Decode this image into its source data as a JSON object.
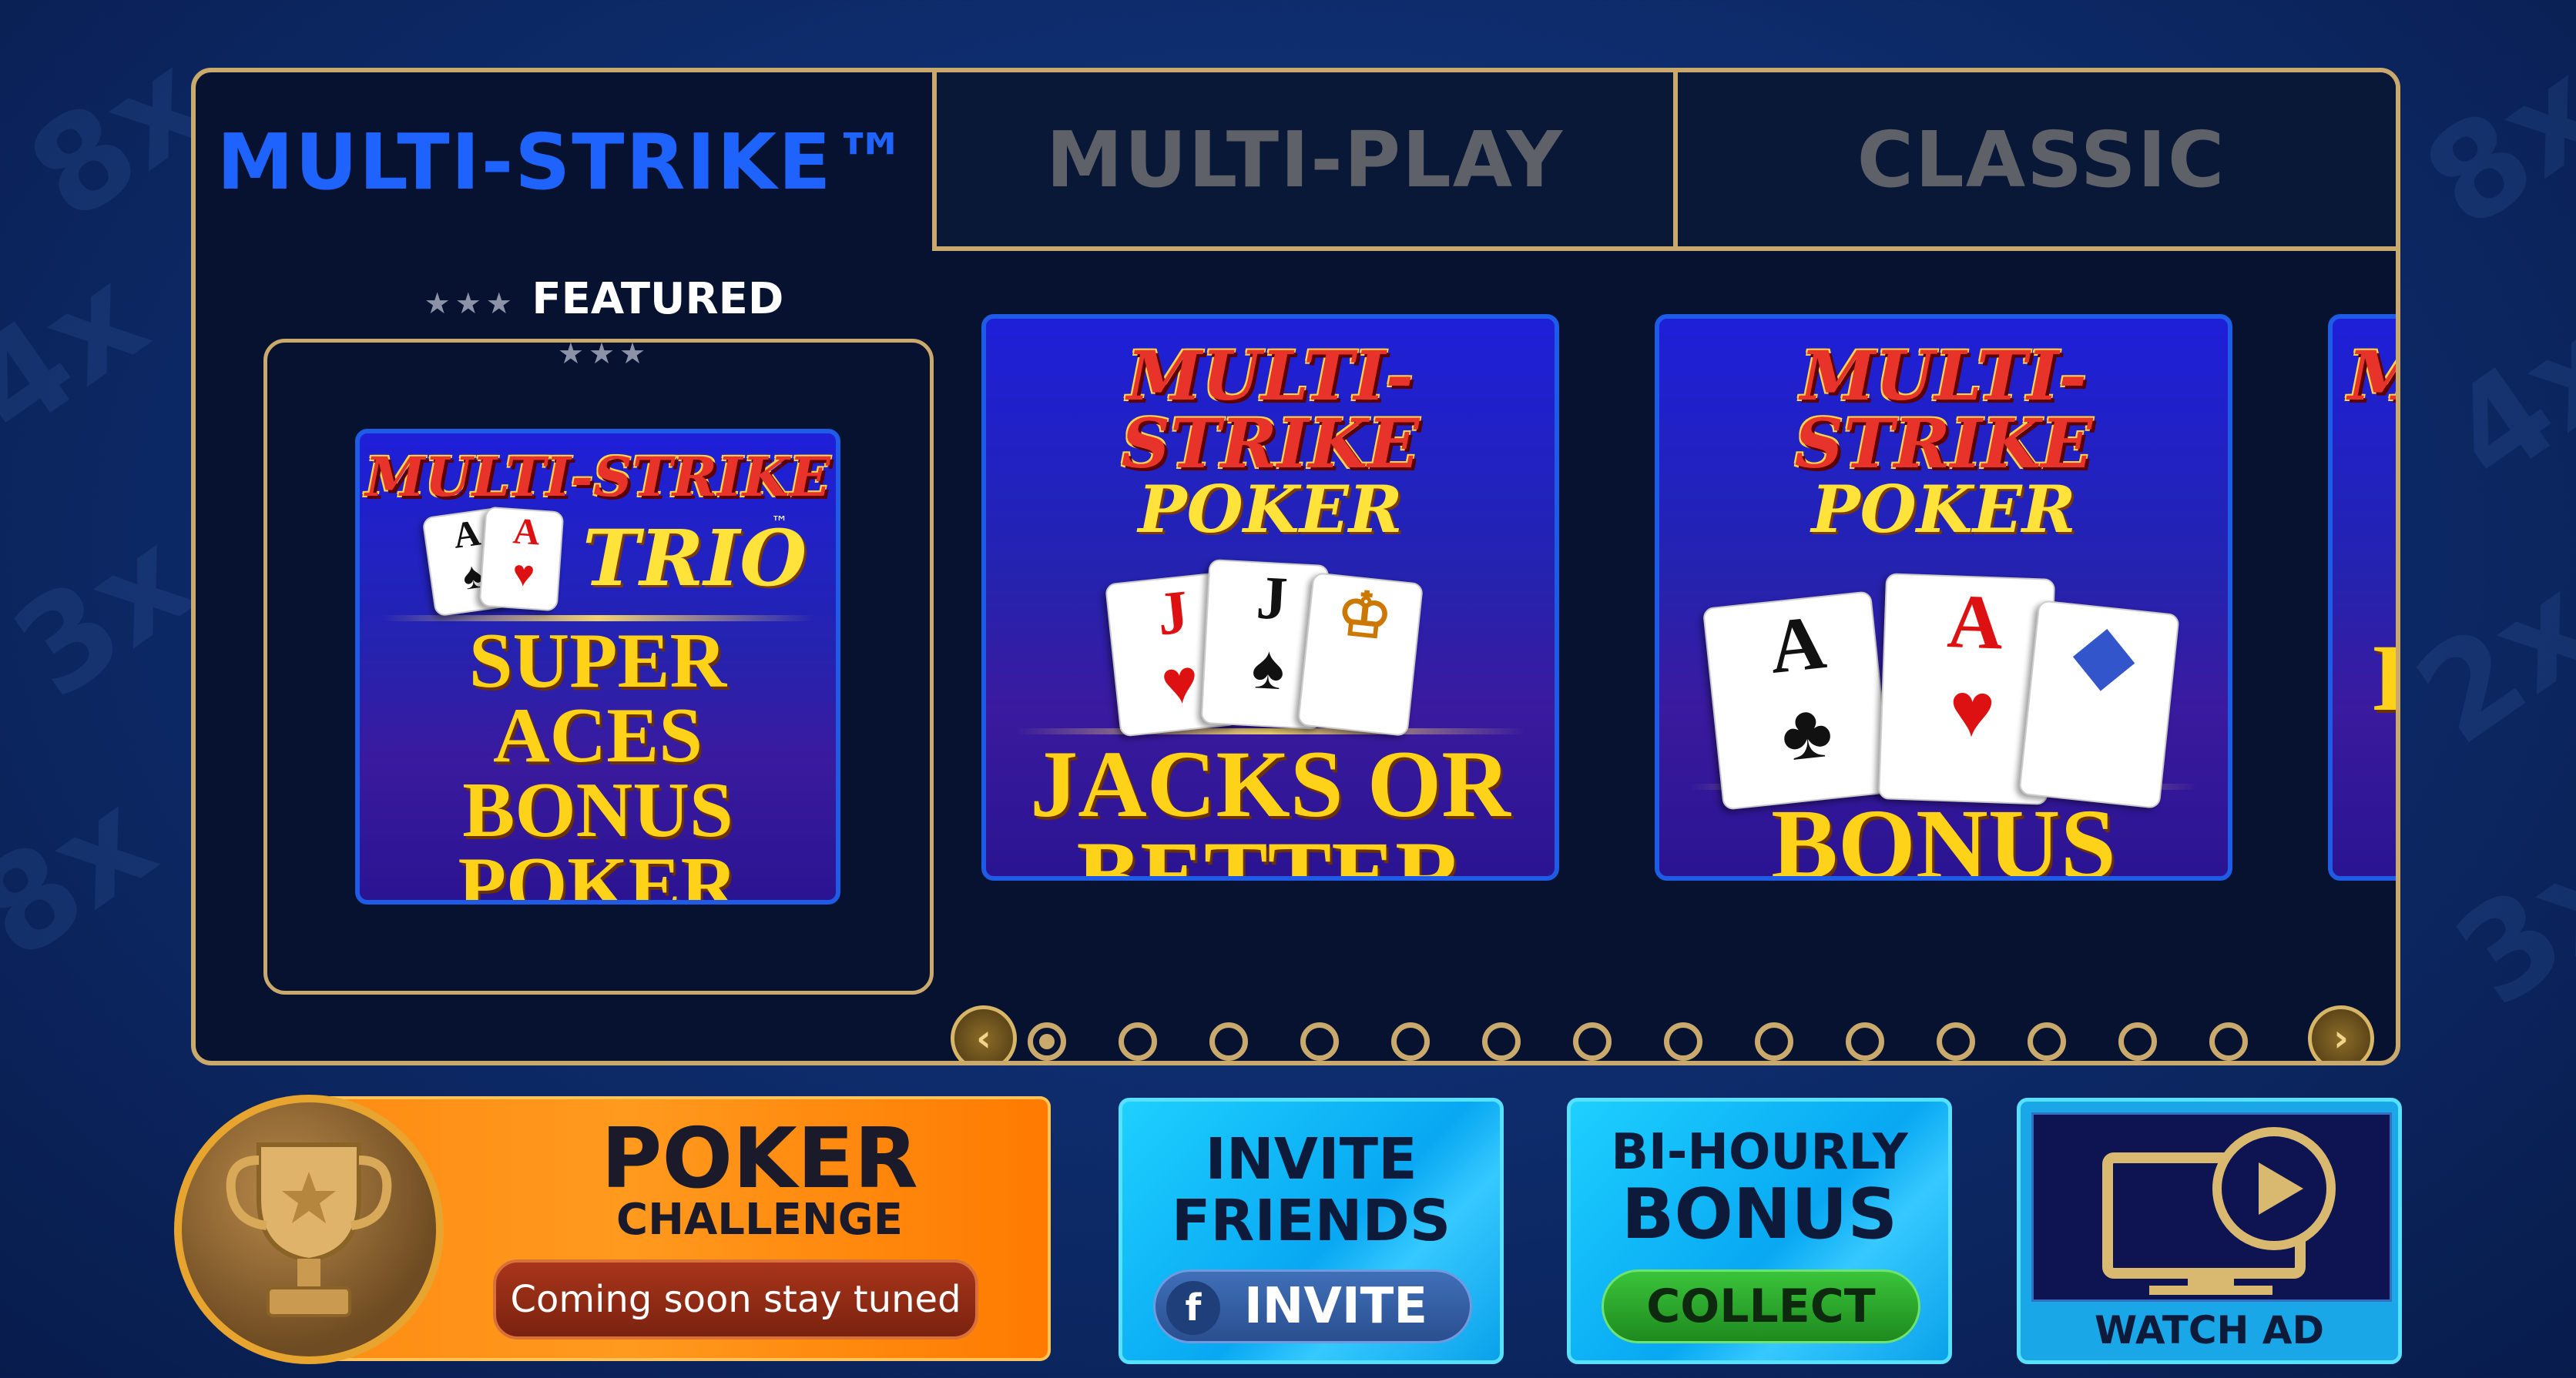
{
  "tabs": [
    {
      "label": "MULTI-STRIKE™",
      "active": true
    },
    {
      "label": "MULTI-PLAY",
      "active": false
    },
    {
      "label": "CLASSIC",
      "active": false
    }
  ],
  "featured": {
    "stars": "★★★",
    "label": "FEATURED",
    "game": {
      "brand": "MULTI-STRIKE",
      "variant": "TRIO",
      "tm": "™",
      "name_lines": [
        "SUPER",
        "ACES",
        "BONUS",
        "POKER"
      ]
    }
  },
  "games": [
    {
      "brand": "MULTI-STRIKE",
      "subtitle": "POKER",
      "tm": "™",
      "name_lines": [
        "JACKS OR",
        "BETTER"
      ]
    },
    {
      "brand": "MULTI-STRIKE",
      "subtitle": "POKER",
      "tm": "™",
      "name_lines": [
        "BONUS"
      ]
    },
    {
      "brand": "M",
      "subtitle": "",
      "tm": "",
      "name_lines": [
        "I"
      ]
    }
  ],
  "pager": {
    "total": 14,
    "active_index": 0,
    "prev_glyph": "‹",
    "next_glyph": "›"
  },
  "challenge": {
    "title": "POKER",
    "subtitle": "CHALLENGE",
    "status": "Coming soon stay tuned"
  },
  "invite": {
    "line1": "INVITE",
    "line2": "FRIENDS",
    "fb_glyph": "f",
    "button": "INVITE"
  },
  "bonus": {
    "line1": "BI-HOURLY",
    "line2": "BONUS",
    "button": "COLLECT"
  },
  "watch": {
    "label": "WATCH AD"
  },
  "colors": {
    "gold": "#c9aa6c",
    "active_tab": "#1f63ff",
    "inactive_tab": "#5e6168",
    "challenge_orange": "#ff8a12",
    "tile_blue": "#08a8f2"
  },
  "background_marks": [
    "8x",
    "4x",
    "3x",
    "2x"
  ]
}
